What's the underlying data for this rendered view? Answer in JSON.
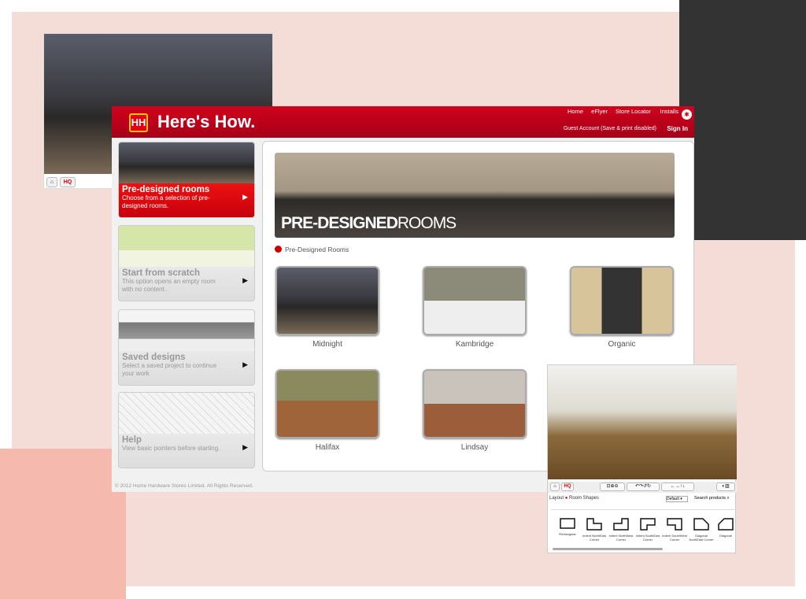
{
  "colors": {
    "brand_red": "#c8001a",
    "accent": "#e40012",
    "background": "#f5ddd7"
  },
  "back_screenshot": {
    "home_icon": "home-icon",
    "hq_label": "HQ"
  },
  "header": {
    "brand": "Here's How.",
    "logo_glyph": "HH",
    "nav": [
      "Home",
      "eFlyer",
      "Store Locator",
      "Installs"
    ],
    "account": "Guest Account (Save & print disabled)",
    "sign_in": "Sign In",
    "flag_icon": "maple-leaf-icon"
  },
  "sidebar": [
    {
      "title": "Pre-designed rooms",
      "desc": "Choose from a selection of pre-designed rooms.",
      "active": true
    },
    {
      "title": "Start from scratch",
      "desc": "This option opens an empty room with no content."
    },
    {
      "title": "Saved designs",
      "desc": "Select a saved project to continue your work"
    },
    {
      "title": "Help",
      "desc": "View basic pointers before starting."
    }
  ],
  "main": {
    "banner_bold": "PRE-DESIGNED",
    "banner_light": "ROOMS",
    "breadcrumb": "Pre-Designed Rooms",
    "rooms": [
      "Midnight",
      "Kambridge",
      "Organic",
      "Halifax",
      "Lindsay"
    ]
  },
  "footer": {
    "copyright": "© 2012 Home Hardware Stores Limited. All Rights Reserved."
  },
  "planner": {
    "hq_label": "HQ",
    "layout": "Layout",
    "room_shapes": "Room Shapes",
    "dropdown": "Default",
    "search_placeholder": "Search products",
    "shapes": [
      "Rectangular",
      "Indent NorthEast Corner",
      "Indent NorthWest Corner",
      "Indent SouthEast Corner",
      "Indent SouthWest Corner",
      "Diagonal NorthEast Corner",
      "Diagonal"
    ]
  }
}
